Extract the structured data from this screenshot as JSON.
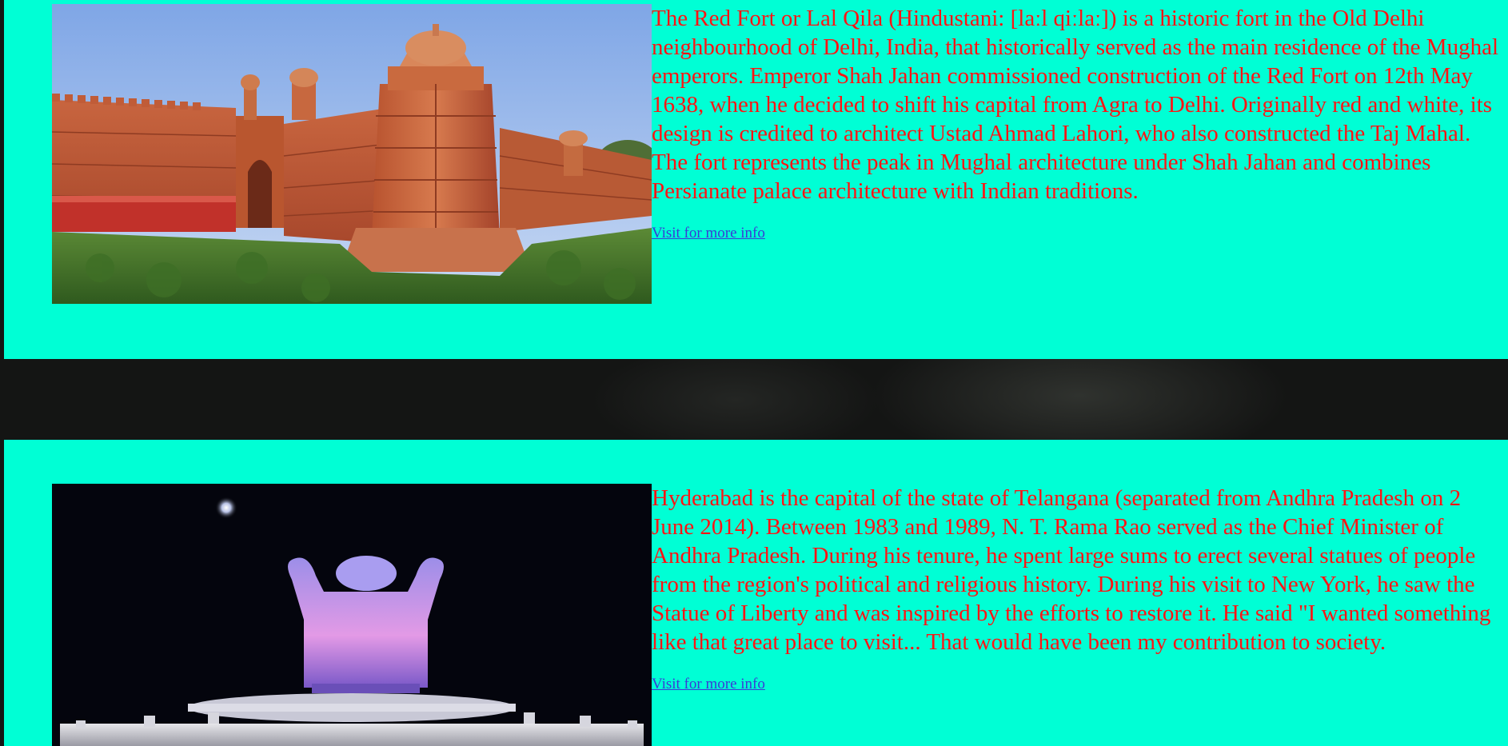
{
  "cards": [
    {
      "image_alt": "Red Fort photograph",
      "description": "The Red Fort or Lal Qila (Hindustani: [laːl qiːlaː]) is a historic fort in the Old Delhi neighbourhood of Delhi, India, that historically served as the main residence of the Mughal emperors. Emperor Shah Jahan commissioned construction of the Red Fort on 12th May 1638, when he decided to shift his capital from Agra to Delhi. Originally red and white, its design is credited to architect Ustad Ahmad Lahori, who also constructed the Taj Mahal. The fort represents the peak in Mughal architecture under Shah Jahan and combines Persianate palace architecture with Indian traditions.",
      "link_label": "Visit for more info"
    },
    {
      "image_alt": "Statue illuminated at night",
      "description": "Hyderabad is the capital of the state of Telangana (separated from Andhra Pradesh on 2 June 2014). Between 1983 and 1989, N. T. Rama Rao served as the Chief Minister of Andhra Pradesh. During his tenure, he spent large sums to erect several statues of people from the region's political and religious history. During his visit to New York, he saw the Statue of Liberty and was inspired by the efforts to restore it. He said \"I wanted something like that great place to visit... That would have been my contribution to society.",
      "link_label": "Visit for more info"
    }
  ],
  "colors": {
    "card_background": "#00ffd5",
    "description_text": "#ff1414",
    "link": "#3a3ad6",
    "page_background": "#141514"
  }
}
